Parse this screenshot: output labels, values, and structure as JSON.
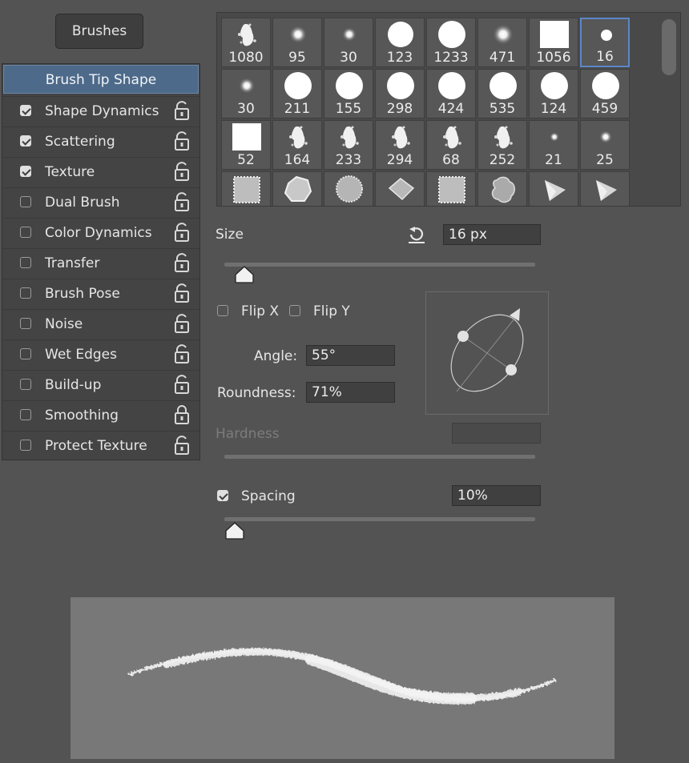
{
  "brushes_button": "Brushes",
  "sidebar": {
    "items": [
      {
        "label": "Brush Tip Shape",
        "active": true,
        "checked": null,
        "locked": null
      },
      {
        "label": "Shape Dynamics",
        "checked": true,
        "locked": false
      },
      {
        "label": "Scattering",
        "checked": true,
        "locked": false
      },
      {
        "label": "Texture",
        "checked": true,
        "locked": false
      },
      {
        "label": "Dual Brush",
        "checked": false,
        "locked": false
      },
      {
        "label": "Color Dynamics",
        "checked": false,
        "locked": false
      },
      {
        "label": "Transfer",
        "checked": false,
        "locked": false
      },
      {
        "label": "Brush Pose",
        "checked": false,
        "locked": false
      },
      {
        "label": "Noise",
        "checked": false,
        "locked": false
      },
      {
        "label": "Wet Edges",
        "checked": false,
        "locked": false
      },
      {
        "label": "Build-up",
        "checked": false,
        "locked": false
      },
      {
        "label": "Smoothing",
        "checked": false,
        "locked": true
      },
      {
        "label": "Protect Texture",
        "checked": false,
        "locked": false
      }
    ]
  },
  "brush_grid": {
    "selected_index": 7,
    "rows": [
      [
        {
          "size": "1080",
          "tip": "splatter"
        },
        {
          "size": "95",
          "tip": "soft-round"
        },
        {
          "size": "30",
          "tip": "soft-round"
        },
        {
          "size": "123",
          "tip": "hard-round"
        },
        {
          "size": "1233",
          "tip": "hard-round"
        },
        {
          "size": "471",
          "tip": "soft-round"
        },
        {
          "size": "1056",
          "tip": "square"
        },
        {
          "size": "16",
          "tip": "hard-round"
        }
      ],
      [
        {
          "size": "30",
          "tip": "soft-round"
        },
        {
          "size": "211",
          "tip": "hard-round"
        },
        {
          "size": "155",
          "tip": "hard-round"
        },
        {
          "size": "298",
          "tip": "hard-round"
        },
        {
          "size": "424",
          "tip": "hard-round"
        },
        {
          "size": "535",
          "tip": "hard-round"
        },
        {
          "size": "124",
          "tip": "hard-round"
        },
        {
          "size": "459",
          "tip": "hard-round"
        }
      ],
      [
        {
          "size": "52",
          "tip": "square"
        },
        {
          "size": "164",
          "tip": "splatter"
        },
        {
          "size": "233",
          "tip": "splatter"
        },
        {
          "size": "294",
          "tip": "splatter"
        },
        {
          "size": "68",
          "tip": "splatter"
        },
        {
          "size": "252",
          "tip": "splatter"
        },
        {
          "size": "21",
          "tip": "soft-round"
        },
        {
          "size": "25",
          "tip": "soft-round"
        }
      ],
      [
        {
          "size": "",
          "tip": "texture-square"
        },
        {
          "size": "",
          "tip": "texture-blob"
        },
        {
          "size": "",
          "tip": "texture-round"
        },
        {
          "size": "",
          "tip": "texture-diamond"
        },
        {
          "size": "",
          "tip": "texture-square"
        },
        {
          "size": "",
          "tip": "texture-cloud"
        },
        {
          "size": "",
          "tip": "shard"
        },
        {
          "size": "",
          "tip": "shard"
        }
      ]
    ]
  },
  "size": {
    "label": "Size",
    "value": "16 px",
    "slider_fraction": 0.006
  },
  "flip": {
    "flip_x_label": "Flip X",
    "flip_x": false,
    "flip_y_label": "Flip Y",
    "flip_y": false
  },
  "angle": {
    "label": "Angle:",
    "value": "55°"
  },
  "roundness": {
    "label": "Roundness:",
    "value": "71%"
  },
  "hardness": {
    "label": "Hardness",
    "value": "",
    "disabled": true
  },
  "spacing": {
    "label": "Spacing",
    "checked": true,
    "value": "10%",
    "slider_fraction": 0.03
  },
  "icons": {
    "reset": "reset-size-icon",
    "lock": "lock-icon"
  }
}
